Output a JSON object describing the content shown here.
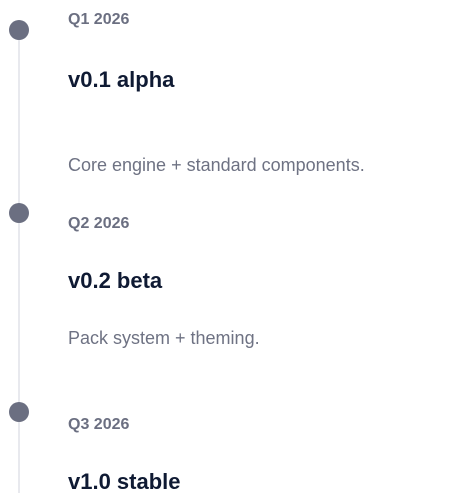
{
  "roadmap": {
    "items": [
      {
        "quarter": "Q1 2026",
        "version": "v0.1 alpha",
        "description": "Core engine + standard components."
      },
      {
        "quarter": "Q2 2026",
        "version": "v0.2 beta",
        "description": "Pack system + theming."
      },
      {
        "quarter": "Q3 2026",
        "version": "v1.0 stable",
        "description": ""
      }
    ]
  }
}
